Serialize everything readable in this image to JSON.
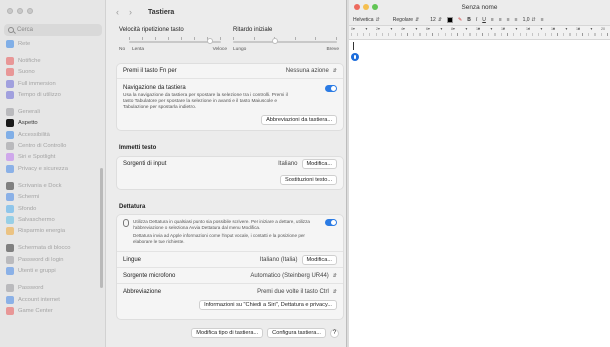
{
  "settings": {
    "search_placeholder": "Cerca",
    "sidebar": [
      {
        "label": "Rete",
        "color": "#1c78e8",
        "faded": true
      },
      {
        "gap": true
      },
      {
        "label": "Notifiche",
        "color": "#e94848",
        "faded": true
      },
      {
        "label": "Suono",
        "color": "#e94848",
        "faded": true
      },
      {
        "label": "Full immersion",
        "color": "#5b59d6",
        "faded": true
      },
      {
        "label": "Tempo di utilizzo",
        "color": "#5b59d6",
        "faded": true
      },
      {
        "gap": true
      },
      {
        "label": "Generali",
        "color": "#8e8e93",
        "faded": true
      },
      {
        "label": "Aspetto",
        "color": "#1a1a1a",
        "faded": false
      },
      {
        "label": "Accessibilità",
        "color": "#1c78e8",
        "faded": true
      },
      {
        "label": "Centro di Controllo",
        "color": "#8e8e93",
        "faded": true
      },
      {
        "label": "Siri e Spotlight",
        "color": "#b86af0",
        "faded": true
      },
      {
        "label": "Privacy e sicurezza",
        "color": "#2f7be8",
        "faded": true
      },
      {
        "gap": true
      },
      {
        "label": "Scrivania e Dock",
        "color": "#1a1a1a",
        "faded": true
      },
      {
        "label": "Schermi",
        "color": "#2f7be8",
        "faded": true
      },
      {
        "label": "Sfondo",
        "color": "#37a5f0",
        "faded": true
      },
      {
        "label": "Salvaschermo",
        "color": "#47b7e6",
        "faded": true
      },
      {
        "label": "Risparmio energia",
        "color": "#f0a020",
        "faded": true
      },
      {
        "gap": true
      },
      {
        "label": "Schermata di blocco",
        "color": "#1a1a1a",
        "faded": true
      },
      {
        "label": "Password di login",
        "color": "#8e8e93",
        "faded": true
      },
      {
        "label": "Utenti e gruppi",
        "color": "#2f7be8",
        "faded": true
      },
      {
        "gap": true
      },
      {
        "label": "Password",
        "color": "#8e8e93",
        "faded": true
      },
      {
        "label": "Account internet",
        "color": "#2f7be8",
        "faded": true
      },
      {
        "label": "Game Center",
        "color": "#e94848",
        "faded": true
      }
    ],
    "title": "Tastiera",
    "key_repeat": {
      "label": "Velocità ripetizione tasto",
      "left": "No",
      "left2": "Lenta",
      "right": "Veloce",
      "level": 0.88
    },
    "delay": {
      "label": "Ritardo iniziale",
      "left": "Lungo",
      "right": "Breve",
      "level": 0.4
    },
    "fn_key": {
      "label": "Premi il tasto Fn per",
      "value": "Nessuna azione"
    },
    "keyboard_nav": {
      "label": "Navigazione da tastiera",
      "description": "Usa la navigazione da tastiera per spostare la selezione tra i controlli. Premi il tasto Tabulatore per spostare la selezione in avanti e il tasto Maiuscole e Tabulazione per spostarla indietro.",
      "shortcuts_button": "Abbreviazioni da tastiera..."
    },
    "text_input": {
      "section": "Immetti testo",
      "sources_label": "Sorgenti di input",
      "sources_value": "Italiano",
      "edit_button": "Modifica...",
      "replacements_button": "Sostituzioni testo..."
    },
    "dictation": {
      "section": "Dettatura",
      "description": "Utilizza Dettatura in qualsiasi punto sia possibile scrivere. Per iniziare a dettare, utilizza l'abbreviazione o seleziona Avvia Dettatura dal menu Modifica.",
      "description2": "Dettatura invia ad Apple informazioni come l'input vocale, i contatti e la posizione per elaborare le tue richieste.",
      "languages_label": "Lingue",
      "languages_value": "Italiano (Italia)",
      "languages_button": "Modifica...",
      "mic_label": "Sorgente microfono",
      "mic_value": "Automatico (Steinberg UR44)",
      "shortcut_label": "Abbreviazione",
      "shortcut_value": "Premi due volte il tasto Ctrl",
      "privacy_button": "Informazioni su \"Chiedi a Siri\", Dettatura e privacy..."
    },
    "footer": {
      "change_type": "Modifica tipo di tastiera...",
      "setup": "Configura tastiera...",
      "help": "?"
    }
  },
  "textedit": {
    "title": "Senza nome",
    "font_family": "Helvetica",
    "font_style": "Regolare",
    "font_size": "12",
    "text_color": "#000000",
    "bold": "B",
    "italic": "I",
    "underline": "U",
    "line_spacing": "1,0",
    "ruler_numbers": [
      "0",
      "2",
      "4",
      "6",
      "8",
      "10",
      "12",
      "14",
      "16",
      "18",
      "20"
    ],
    "traffic_colors": [
      "#ed6a5e",
      "#f5bf4f",
      "#61c554"
    ]
  }
}
